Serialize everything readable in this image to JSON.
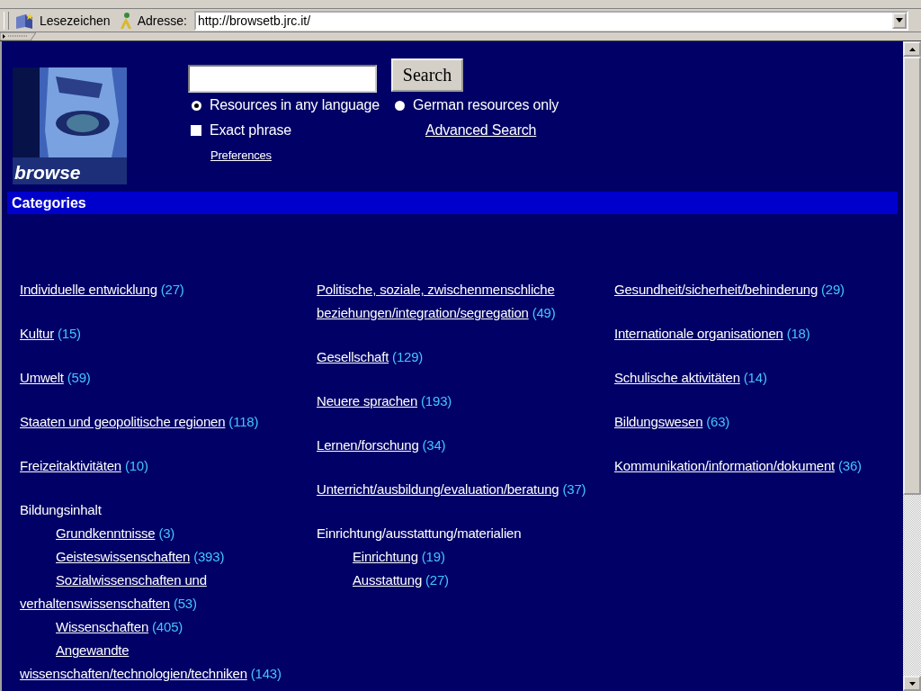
{
  "toolbar": {
    "bookmarks": "Lesezeichen",
    "address_label": "Adresse:",
    "url": "http://browsetb.jrc.it/"
  },
  "page": {
    "logo": {
      "kind": "picture",
      "caption": "browse"
    },
    "search": {
      "button": "Search",
      "language_options": [
        {
          "label": "Resources in any language",
          "selected": true
        },
        {
          "label": "German resources only",
          "selected": false
        }
      ],
      "exact_phrase": {
        "label": "Exact phrase",
        "checked": false
      },
      "advanced_search": "Advanced Search",
      "preferences": "Preferences"
    },
    "categories": {
      "title": "Categories",
      "columns": [
        {
          "items": [
            {
              "label": "Individuelle entwicklung",
              "count": "(27)"
            },
            {
              "label": "Kultur",
              "count": "(15)"
            },
            {
              "label": "Umwelt",
              "count": "(59)"
            },
            {
              "label": "Staaten und geopolitische regionen",
              "count": "(118)"
            },
            {
              "label": "Freizeitaktivitäten",
              "count": "(10)"
            },
            {
              "label": "Bildungsinhalt",
              "children": [
                {
                  "label": "Grundkenntnisse",
                  "count": "(3)"
                },
                {
                  "label": "Geisteswissenschaften",
                  "count": "(393)"
                },
                {
                  "label": "Sozialwissenschaften und verhaltenswissenschaften",
                  "count": "(53)"
                },
                {
                  "label": "Wissenschaften",
                  "count": "(405)"
                },
                {
                  "label": "Angewandte wissenschaften/technologien/techniken",
                  "count": "(143)"
                }
              ]
            }
          ]
        },
        {
          "items": [
            {
              "label": "Politische, soziale, zwischenmenschliche beziehungen/integration/segregation",
              "count": "(49)"
            },
            {
              "label": "Gesellschaft",
              "count": "(129)"
            },
            {
              "label": "Neuere sprachen",
              "count": "(193)"
            },
            {
              "label": "Lernen/forschung",
              "count": "(34)"
            },
            {
              "label": "Unterricht/ausbildung/evaluation/beratung",
              "count": "(37)"
            },
            {
              "label": "Einrichtung/ausstattung/materialien",
              "children": [
                {
                  "label": "Einrichtung",
                  "count": "(19)"
                },
                {
                  "label": "Ausstattung",
                  "count": "(27)"
                }
              ]
            }
          ]
        },
        {
          "items": [
            {
              "label": "Gesundheit/sicherheit/behinderung",
              "count": "(29)"
            },
            {
              "label": "Internationale organisationen",
              "count": "(18)"
            },
            {
              "label": "Schulische aktivitäten",
              "count": "(14)"
            },
            {
              "label": "Bildungswesen",
              "count": "(63)"
            },
            {
              "label": "Kommunikation/information/dokument",
              "count": "(36)"
            }
          ]
        }
      ]
    }
  }
}
